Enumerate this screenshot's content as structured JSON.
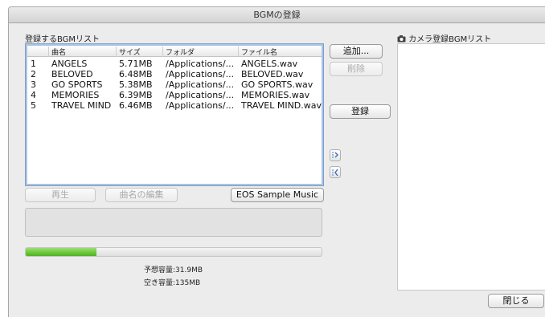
{
  "window": {
    "title": "BGMの登録"
  },
  "bgm_list": {
    "label": "登録するBGMリスト",
    "columns": [
      "",
      "曲名",
      "サイズ",
      "フォルダ",
      "ファイル名"
    ],
    "rows": [
      [
        "1",
        "ANGELS",
        "5.71MB",
        "/Applications/...",
        "ANGELS.wav"
      ],
      [
        "2",
        "BELOVED",
        "6.48MB",
        "/Applications/...",
        "BELOVED.wav"
      ],
      [
        "3",
        "GO SPORTS",
        "5.38MB",
        "/Applications/...",
        "GO SPORTS.wav"
      ],
      [
        "4",
        "MEMORIES",
        "6.39MB",
        "/Applications/...",
        "MEMORIES.wav"
      ],
      [
        "5",
        "TRAVEL MIND",
        "6.46MB",
        "/Applications/...",
        "TRAVEL MIND.wav"
      ]
    ]
  },
  "buttons": {
    "add": "追加...",
    "delete": "削除",
    "register": "登録",
    "play": "再生",
    "edit_title": "曲名の編集",
    "eos_sample": "EOS Sample Music",
    "close": "閉じる"
  },
  "progress": {
    "fraction": 0.24
  },
  "capacity": {
    "estimated": "予想容量:31.9MB",
    "free": "空き容量:135MB"
  },
  "camera_list": {
    "label": "カメラ登録BGMリスト"
  },
  "icons": {
    "move_up": "move-up-icon",
    "move_down": "move-down-icon",
    "camera": "camera-icon"
  }
}
